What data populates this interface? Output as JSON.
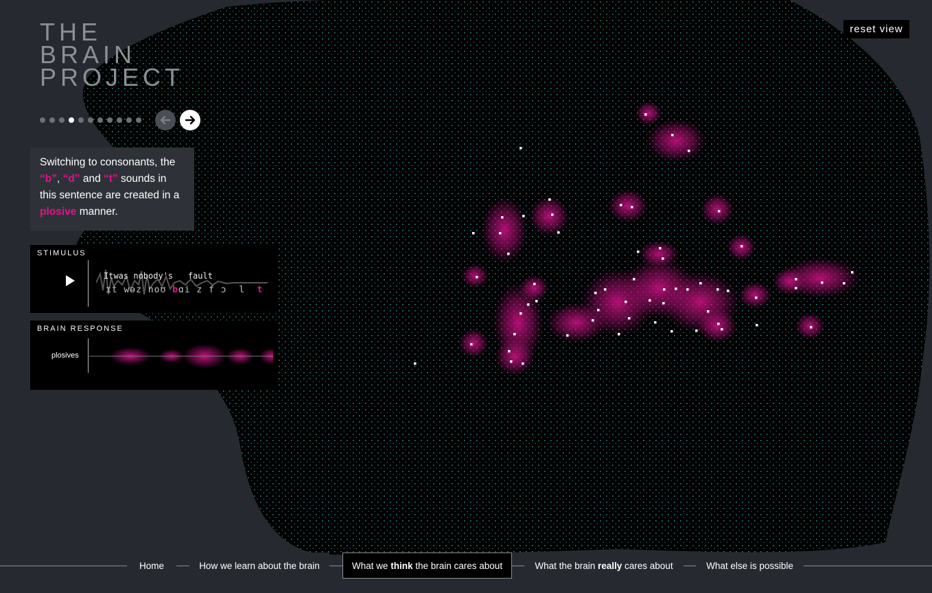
{
  "logo": {
    "line1": "THE",
    "line2": "BRAIN",
    "line3": "PROJECT"
  },
  "reset_label": "reset view",
  "pager": {
    "count": 11,
    "active_index": 3
  },
  "caption": {
    "t1": "Switching to consonants, the ",
    "b": "“b”",
    "t2": ", ",
    "d": "“d”",
    "t3": " and ",
    "t": "“t”",
    "t4": " sounds in this sentence are created in a ",
    "plosive": "plosive",
    "t5": " manner."
  },
  "stimulus": {
    "title": "STIMULUS",
    "words": "Itwas nobody's   fault",
    "phon_pre": "ɪt wəz noʊ ",
    "phon_hl": "b",
    "phon_mid": "ɑ",
    "phon_post": "i z f ɔ  l  ",
    "phon_hl2": "t"
  },
  "response": {
    "title": "BRAIN RESPONSE",
    "label": "plosives"
  },
  "bottom_nav": {
    "home": "Home",
    "learn": "How we learn about the brain",
    "think_pre": "What we ",
    "think_bold": "think",
    "think_post": " the brain cares about",
    "really_pre": "What the brain ",
    "really_bold": "really",
    "really_post": " cares about",
    "else": "What else is possible"
  },
  "colors": {
    "background": "#262a30",
    "dots": "#3aa6ad",
    "highlight": "#e0138c",
    "panel": "#000000"
  }
}
